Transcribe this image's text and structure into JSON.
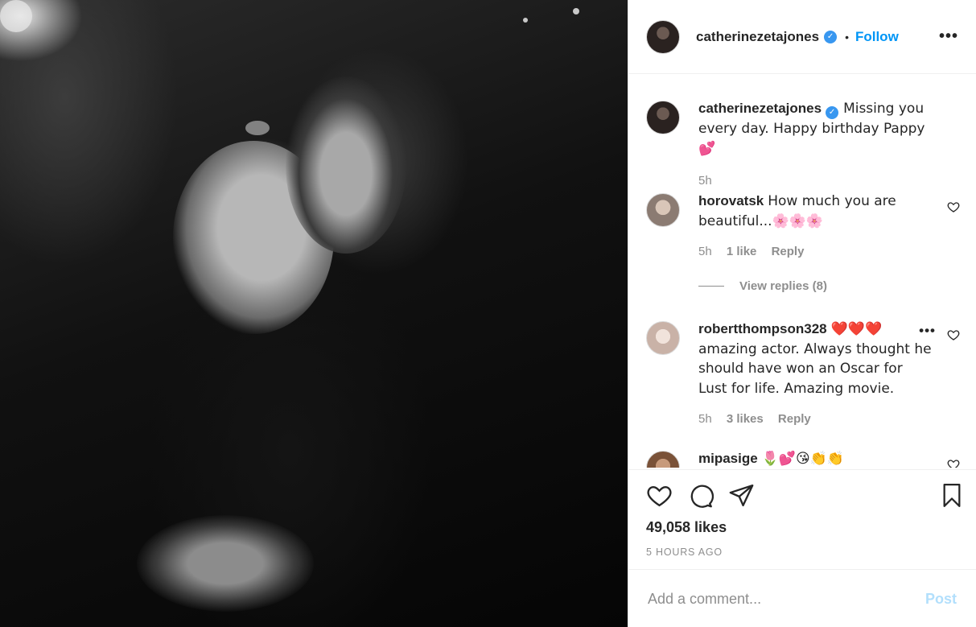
{
  "post": {
    "username": "catherinezetajones",
    "follow_label": "Follow",
    "separator": "•",
    "more_label": "•••"
  },
  "caption": {
    "username": "catherinezetajones",
    "text": "Missing you every day. Happy birthday Pappy 💕",
    "time": "5h"
  },
  "comments": [
    {
      "username": "horovatsk",
      "text": "How much you are beautiful...🌸🌸🌸",
      "time": "5h",
      "likes": "1 like",
      "reply": "Reply",
      "view_replies": "View replies (8)"
    },
    {
      "username": "robertthompson328",
      "text": "❤️❤️❤️ amazing actor. Always thought he should have won an Oscar for Lust for life. Amazing movie.",
      "time": "5h",
      "likes": "3 likes",
      "reply": "Reply"
    },
    {
      "username": "mipasige",
      "text": "🌷💕😘👏👏"
    }
  ],
  "footer": {
    "likes": "49,058 likes",
    "ago": "5 HOURS AGO"
  },
  "comment_box": {
    "placeholder": "Add a comment...",
    "post_label": "Post"
  },
  "icons": [
    "heart-icon",
    "comment-icon",
    "share-icon",
    "bookmark-icon",
    "verified-badge-icon",
    "more-options-icon"
  ],
  "colors": {
    "accent": "#0095f6",
    "verified": "#3897f0",
    "muted": "#8e8e8e",
    "post_disabled": "#b2dffc"
  }
}
